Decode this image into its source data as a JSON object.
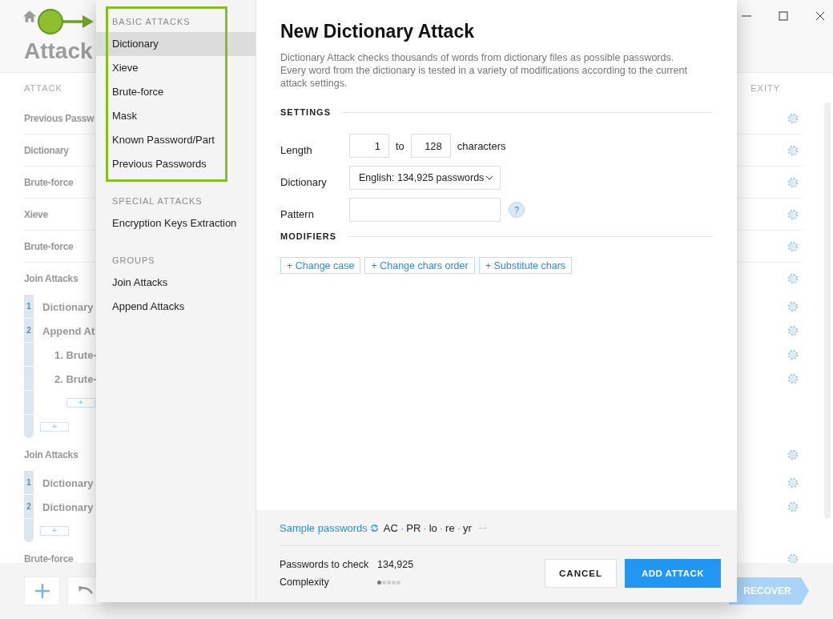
{
  "background": {
    "title": "Attack",
    "column_1": "ATTACK",
    "column_2": "EXITY",
    "rows": [
      {
        "kind": "attack",
        "label": "Previous Passw"
      },
      {
        "kind": "attack",
        "label": "Dictionary"
      },
      {
        "kind": "attack",
        "label": "Brute-force"
      },
      {
        "kind": "attack",
        "label": "Xieve"
      },
      {
        "kind": "attack",
        "label": "Brute-force"
      },
      {
        "kind": "group",
        "label": "Join Attacks",
        "add_label": "+",
        "members": [
          {
            "number": "1",
            "label": "Dictionary"
          },
          {
            "number": "2",
            "label": "Append At",
            "add_label": "+",
            "children": [
              {
                "label": "1. Brute-"
              },
              {
                "label": "2. Brute-"
              }
            ]
          }
        ]
      },
      {
        "kind": "group",
        "label": "Join Attacks",
        "add_label": "+",
        "members": [
          {
            "number": "1",
            "label": "Dictionary"
          },
          {
            "number": "2",
            "label": "Dictionary"
          }
        ]
      },
      {
        "kind": "attack",
        "label": "Brute-force"
      }
    ],
    "recover": "RECOVER"
  },
  "modal": {
    "sidebar": {
      "sections": [
        {
          "heading": "BASIC ATTACKS",
          "items": [
            {
              "label": "Dictionary",
              "selected": true
            },
            {
              "label": "Xieve",
              "selected": false
            },
            {
              "label": "Brute-force",
              "selected": false
            },
            {
              "label": "Mask",
              "selected": false
            },
            {
              "label": "Known Password/Part",
              "selected": false
            },
            {
              "label": "Previous Passwords",
              "selected": false
            }
          ]
        },
        {
          "heading": "SPECIAL ATTACKS",
          "items": [
            {
              "label": "Encryption Keys Extraction",
              "selected": false
            }
          ]
        },
        {
          "heading": "GROUPS",
          "items": [
            {
              "label": "Join Attacks",
              "selected": false
            },
            {
              "label": "Append Attacks",
              "selected": false
            }
          ]
        }
      ]
    },
    "title": "New Dictionary Attack",
    "description": "Dictionary Attack checks thousands of words from dictionary files as possible passwords. Every word from the dictionary is tested in a variety of modifications according to the current attack settings.",
    "settings": {
      "heading": "SETTINGS",
      "length_label": "Length",
      "length_from": "1",
      "to": "to",
      "length_to": "128",
      "unit": "characters",
      "dictionary_label": "Dictionary",
      "dictionary_value": "English: 134,925 passwords",
      "pattern_label": "Pattern",
      "help": "?"
    },
    "modifiers": {
      "heading": "MODIFIERS",
      "buttons": [
        {
          "icon": "+",
          "label": "Change case"
        },
        {
          "icon": "+",
          "label": "Change chars order"
        },
        {
          "icon": "+",
          "label": "Substitute chars"
        }
      ]
    },
    "footer": {
      "sample_link": "Sample passwords",
      "samples": [
        "AC",
        "PR",
        "lo",
        "re",
        "yr"
      ],
      "separator": "·",
      "more": "···",
      "passwords_label": "Passwords to check",
      "passwords_value": "134,925",
      "complexity_label": "Complexity",
      "complexity": {
        "level": 0.2
      },
      "cancel": "CANCEL",
      "add": "ADD ATTACK"
    }
  }
}
